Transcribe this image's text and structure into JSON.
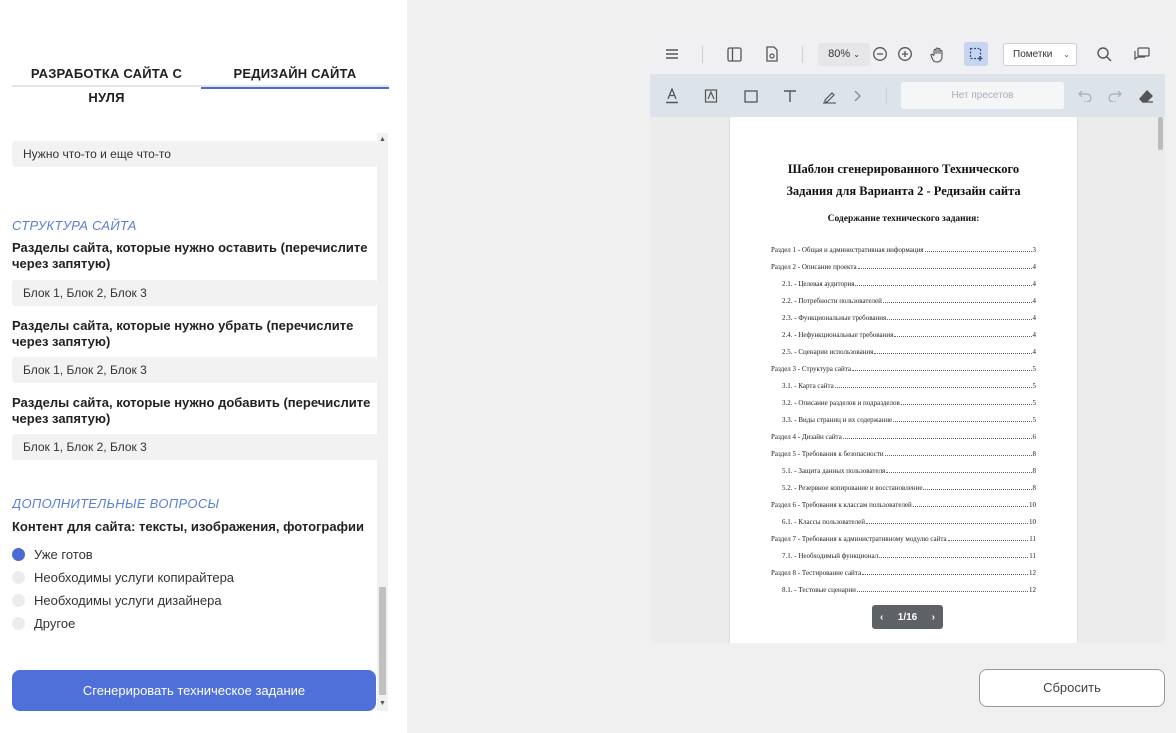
{
  "tabs": {
    "from_scratch": "РАЗРАБОТКА САЙТА С НУЛЯ",
    "redesign": "РЕДИЗАЙН САЙТА"
  },
  "form": {
    "top_field_value": "Нужно что-то и еще что-то",
    "structure": {
      "section_title": "СТРУКТУРА САЙТА",
      "keep_label": "Разделы сайта, которые нужно оставить (перечислите через запятую)",
      "keep_value": "Блок 1, Блок 2, Блок 3",
      "remove_label": "Разделы сайта, которые нужно убрать (перечислите через запятую)",
      "remove_value": "Блок 1, Блок 2, Блок 3",
      "add_label": "Разделы сайта, которые нужно добавить (перечислите через запятую)",
      "add_value": "Блок 1, Блок 2, Блок 3"
    },
    "additional": {
      "section_title": "ДОПОЛНИТЕЛЬНЫЕ ВОПРОСЫ",
      "content_label": "Контент для сайта: тексты, изображения, фотографии",
      "options": [
        {
          "label": "Уже готов",
          "checked": true
        },
        {
          "label": "Необходимы услуги копирайтера",
          "checked": false
        },
        {
          "label": "Необходимы услуги дизайнера",
          "checked": false
        },
        {
          "label": "Другое",
          "checked": false
        }
      ]
    },
    "generate_button": "Сгенерировать техническое задание"
  },
  "viewer": {
    "zoom": "80%",
    "annotations_select": "Пометки",
    "presets_placeholder": "Нет пресетов",
    "document": {
      "title_line1": "Шаблон сгенерированного Технического",
      "title_line2": "Задания для Варианта 2 - Редизайн сайта",
      "toc_heading": "Содержание технического задания:",
      "toc": [
        {
          "text": "Раздел 1 - Общая и административная информация",
          "page": "3",
          "sub": false
        },
        {
          "text": "Раздел 2 - Описание проекта",
          "page": "4",
          "sub": false
        },
        {
          "text": "2.1. - Целевая аудитория",
          "page": "4",
          "sub": true
        },
        {
          "text": "2.2. - Потребности пользователей",
          "page": "4",
          "sub": true
        },
        {
          "text": "2.3. - Функциональные требования",
          "page": "4",
          "sub": true
        },
        {
          "text": "2.4. - Нефункциональные требования",
          "page": "4",
          "sub": true
        },
        {
          "text": "2.5. - Сценарии использования",
          "page": "4",
          "sub": true
        },
        {
          "text": "Раздел 3 - Структура сайта",
          "page": "5",
          "sub": false
        },
        {
          "text": "3.1. - Карта сайта",
          "page": "5",
          "sub": true
        },
        {
          "text": "3.2. - Описание разделов и подразделов",
          "page": "5",
          "sub": true
        },
        {
          "text": "3.3. - Виды страниц и их содержание",
          "page": "5",
          "sub": true
        },
        {
          "text": "Раздел 4 - Дизайн сайта",
          "page": "6",
          "sub": false
        },
        {
          "text": "Раздел 5 - Требования к безопасности",
          "page": "8",
          "sub": false
        },
        {
          "text": "5.1. - Защита данных пользователя",
          "page": "8",
          "sub": true
        },
        {
          "text": "5.2. - Резервное копирование и восстановление",
          "page": "8",
          "sub": true
        },
        {
          "text": "Раздел 6 - Требования к классам пользователей",
          "page": "10",
          "sub": false
        },
        {
          "text": "6.1. - Классы пользователей",
          "page": "10",
          "sub": true
        },
        {
          "text": "Раздел 7 - Требования к административному модулю сайта",
          "page": "11",
          "sub": false
        },
        {
          "text": "7.1. - Необходимый функционал",
          "page": "11",
          "sub": true
        },
        {
          "text": "Раздел 8 - Тестирование сайта",
          "page": "12",
          "sub": false
        },
        {
          "text": "8.1. - Тестовые сценарии",
          "page": "12",
          "sub": true
        }
      ]
    },
    "pager": {
      "current": "1",
      "total": "16",
      "separator": "/"
    }
  },
  "reset_button": "Сбросить",
  "colors": {
    "accent": "#4f70d8",
    "section_title": "#5b7fd6",
    "active_tool": "#c7d6ee"
  }
}
